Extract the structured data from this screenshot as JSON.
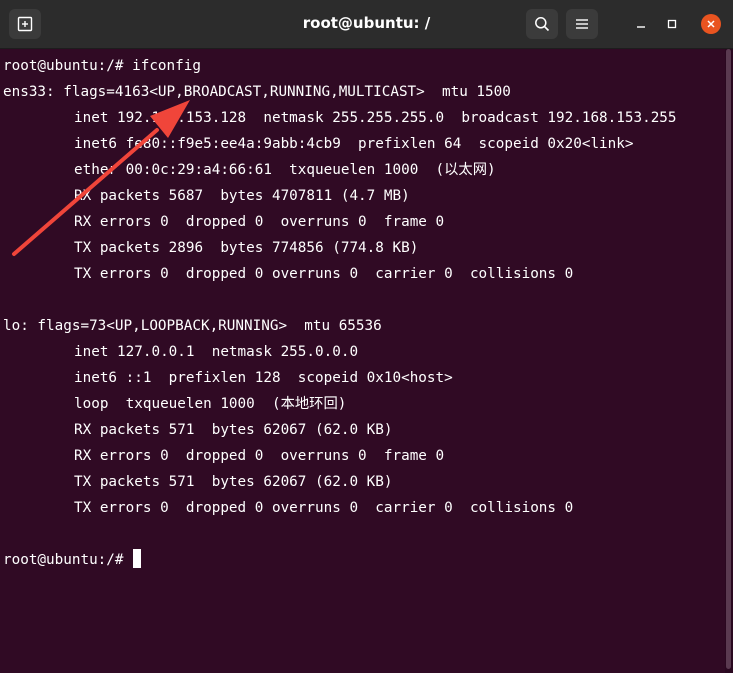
{
  "window": {
    "title": "root@ubuntu: /"
  },
  "icons": {
    "new_tab": "new-tab-icon",
    "search": "search-icon",
    "menu": "hamburger-menu-icon",
    "minimize": "minimize-icon",
    "maximize": "maximize-icon",
    "close": "close-icon",
    "annotation": "red-arrow-icon"
  },
  "colors": {
    "terminal_bg": "#300a24",
    "close_button": "#e95420",
    "annotation_arrow": "#f0453a"
  },
  "terminal": {
    "lines": [
      "root@ubuntu:/# ifconfig",
      "ens33: flags=4163<UP,BROADCAST,RUNNING,MULTICAST>  mtu 1500",
      "inet 192.168.153.128  netmask 255.255.255.0  broadcast 192.168.153.255",
      "inet6 fe80::f9e5:ee4a:9abb:4cb9  prefixlen 64  scopeid 0x20<link>",
      "ether 00:0c:29:a4:66:61  txqueuelen 1000  (以太网)",
      "RX packets 5687  bytes 4707811 (4.7 MB)",
      "RX errors 0  dropped 0  overruns 0  frame 0",
      "TX packets 2896  bytes 774856 (774.8 KB)",
      "TX errors 0  dropped 0 overruns 0  carrier 0  collisions 0",
      "",
      "lo: flags=73<UP,LOOPBACK,RUNNING>  mtu 65536",
      "inet 127.0.0.1  netmask 255.0.0.0",
      "inet6 ::1  prefixlen 128  scopeid 0x10<host>",
      "loop  txqueuelen 1000  (本地环回)",
      "RX packets 571  bytes 62067 (62.0 KB)",
      "RX errors 0  dropped 0  overruns 0  frame 0",
      "TX packets 571  bytes 62067 (62.0 KB)",
      "TX errors 0  dropped 0 overruns 0  carrier 0  collisions 0",
      "",
      "root@ubuntu:/# "
    ]
  }
}
